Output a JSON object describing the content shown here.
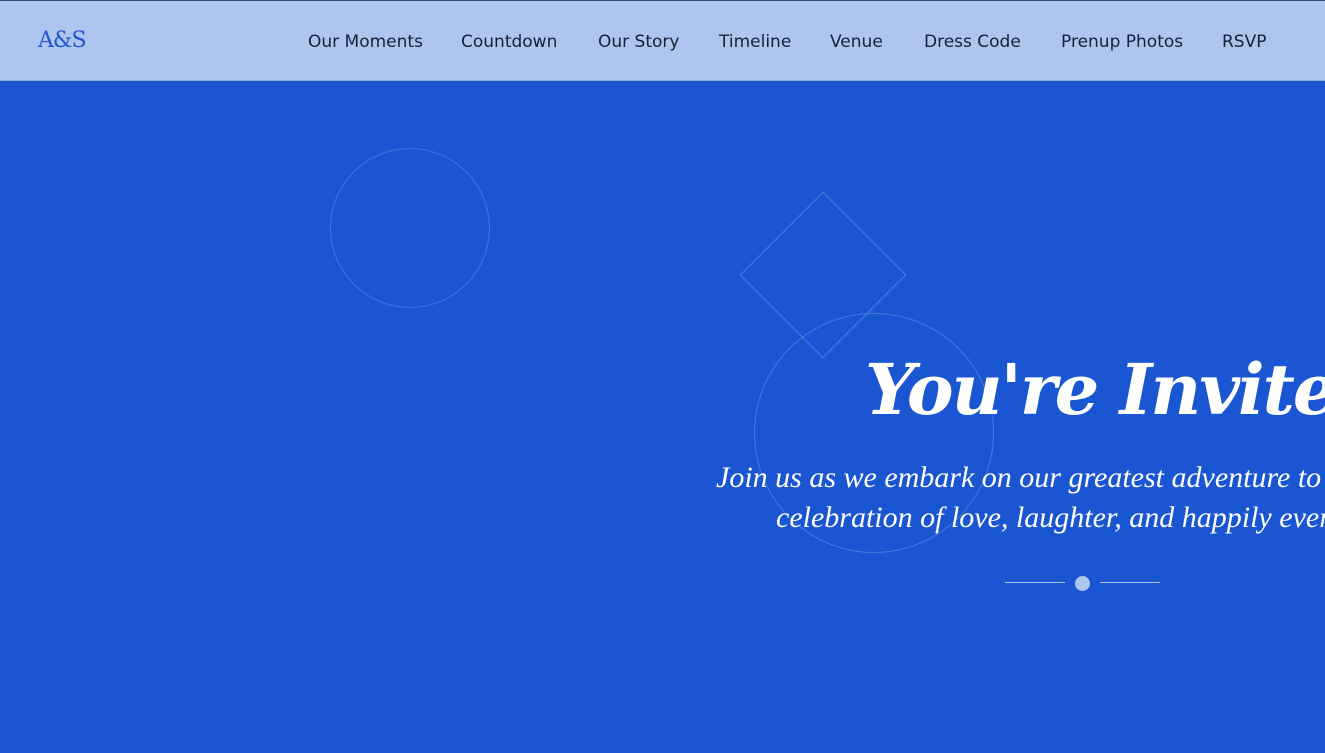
{
  "brand": {
    "logo_text": "A&S"
  },
  "nav": {
    "items": [
      {
        "label": "Our Moments"
      },
      {
        "label": "Countdown"
      },
      {
        "label": "Our Story"
      },
      {
        "label": "Timeline"
      },
      {
        "label": "Venue"
      },
      {
        "label": "Dress Code"
      },
      {
        "label": "Prenup Photos"
      },
      {
        "label": "RSVP"
      }
    ]
  },
  "hero": {
    "title": "You're Invited!",
    "subtitle_line1": "Join us as we embark on our greatest adventure to",
    "subtitle_line2": "celebration of love, laughter, and happily ever"
  },
  "colors": {
    "hero_background": "#1a56d2",
    "navbar_background": "#aec5ee",
    "nav_text": "#16203a",
    "logo": "#2455c9",
    "hero_text": "#ffffff",
    "divider": "#aec5ee"
  }
}
